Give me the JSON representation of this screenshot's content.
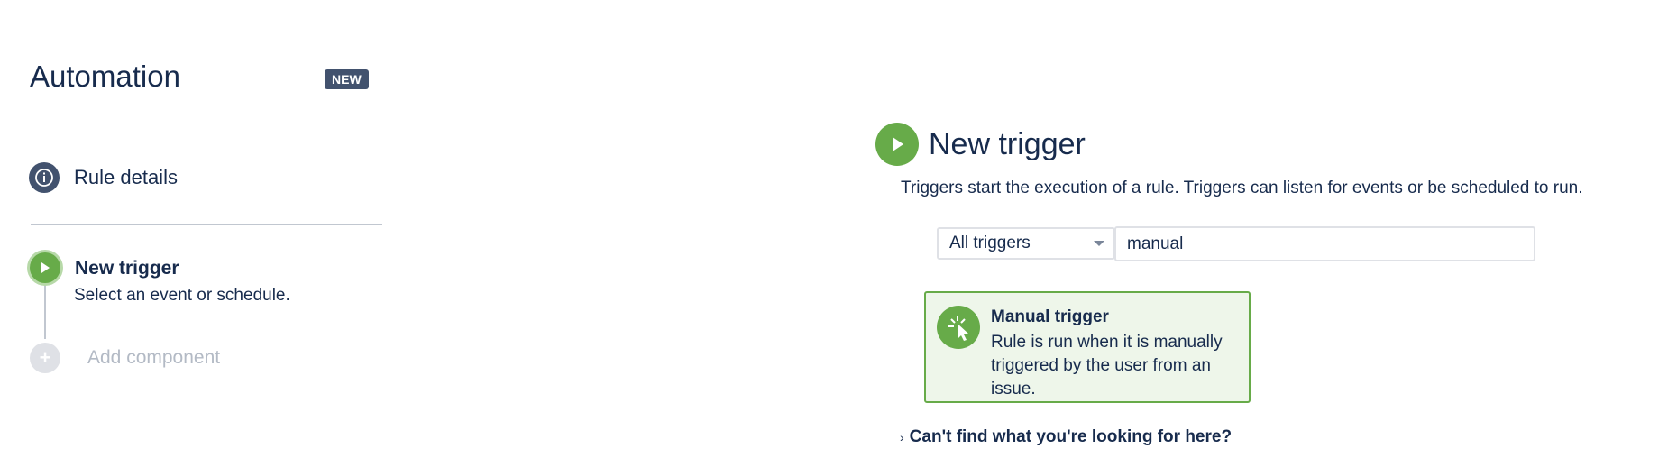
{
  "sidebar": {
    "title": "Automation",
    "badge": "NEW",
    "rule_details": "Rule details",
    "trigger_step_title": "New trigger",
    "trigger_step_subtitle": "Select an event or schedule.",
    "add_component": "Add component"
  },
  "main": {
    "title": "New trigger",
    "description": "Triggers start the execution of a rule. Triggers can listen for events or be scheduled to run.",
    "filter": {
      "selected": "All triggers",
      "search_value": "manual"
    },
    "result": {
      "title": "Manual trigger",
      "description": "Rule is run when it is manually triggered by the user from an issue."
    },
    "help_link": "Can't find what you're looking for here?"
  },
  "colors": {
    "accent_green": "#67ab49",
    "dark_slate": "#42526e",
    "card_background": "#eef6ea"
  },
  "icons": [
    "info-icon",
    "play-icon",
    "plus-icon",
    "cursor-click-icon",
    "chevron-right-icon",
    "chevron-down-icon"
  ]
}
